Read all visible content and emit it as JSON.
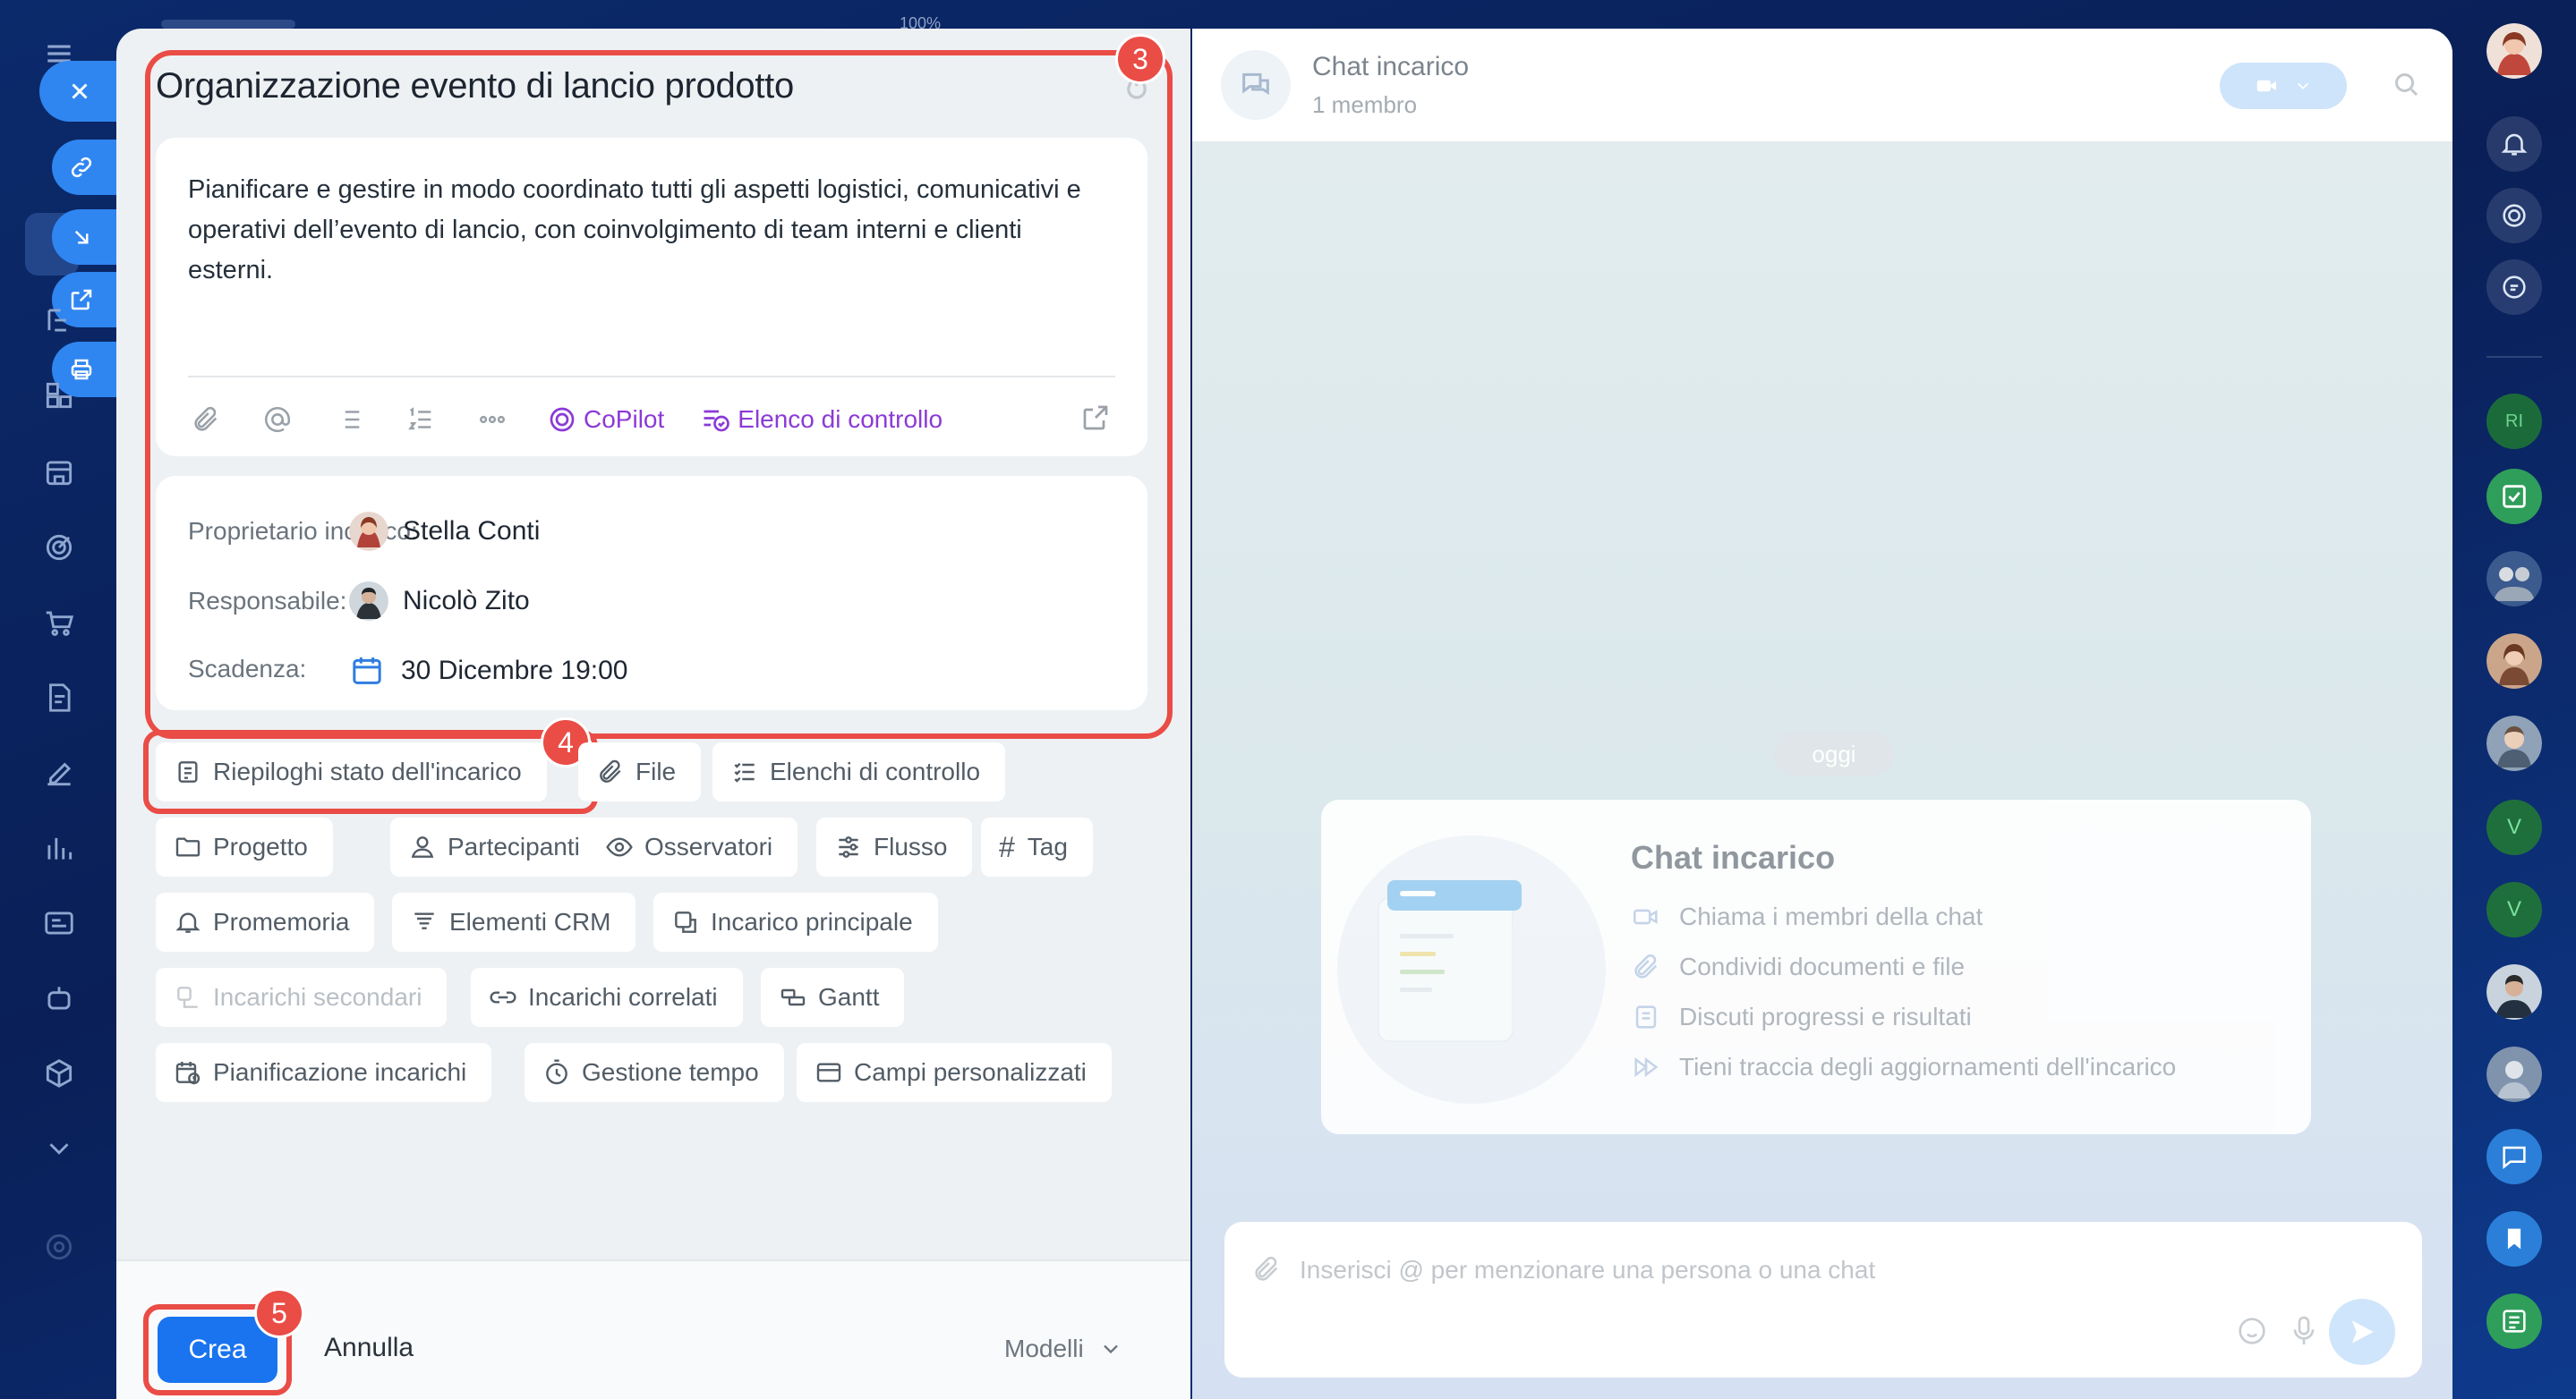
{
  "app": {
    "zoom_label": "100%"
  },
  "task": {
    "title": "Organizzazione evento di lancio prodotto",
    "description": "Pianificare e gestire in modo coordinato tutti gli aspetti logistici, comunicativi e operativi dell’evento di lancio, con coinvolgimento di team interni e clienti esterni.",
    "toolbar": {
      "copilot": "CoPilot",
      "checklist": "Elenco di controllo"
    },
    "fields": {
      "owner_label": "Proprietario incarico:",
      "owner_value": "Stella Conti",
      "responsible_label": "Responsabile:",
      "responsible_value": "Nicolò Zito",
      "deadline_label": "Scadenza:",
      "deadline_value": "30 Dicembre 19:00"
    }
  },
  "chips": {
    "status_summaries": "Riepiloghi stato dell'incarico",
    "files": "File",
    "checklists": "Elenchi di controllo",
    "project": "Progetto",
    "participants": "Partecipanti",
    "observers": "Osservatori",
    "flow": "Flusso",
    "tag": "Tag",
    "reminder": "Promemoria",
    "crm": "Elementi CRM",
    "parent_task": "Incarico principale",
    "subtasks": "Incarichi secondari",
    "related": "Incarichi correlati",
    "gantt": "Gantt",
    "planning": "Pianificazione incarichi",
    "time_tracking": "Gestione tempo",
    "custom_fields": "Campi personalizzati"
  },
  "footer": {
    "create": "Crea",
    "cancel": "Annulla",
    "templates": "Modelli"
  },
  "badges": {
    "b3": "3",
    "b4": "4",
    "b5": "5"
  },
  "chat": {
    "title": "Chat incarico",
    "subtitle": "1 membro",
    "today": "oggi",
    "welcome_title": "Chat incarico",
    "welcome_items": [
      "Chiama i membri della chat",
      "Condividi documenti e file",
      "Discuti progressi e risultati",
      "Tieni traccia degli aggiornamenti dell'incarico"
    ],
    "input_placeholder": "Inserisci @ per menzionare una persona o una chat"
  },
  "rightbar": {
    "initials_1": "RI",
    "initials_2": "V",
    "initials_3": "V"
  },
  "colors": {
    "accent": "#1a74ef",
    "highlight": "#ea4c46",
    "copilot": "#8b3ad7",
    "panel": "#eef1f3"
  }
}
